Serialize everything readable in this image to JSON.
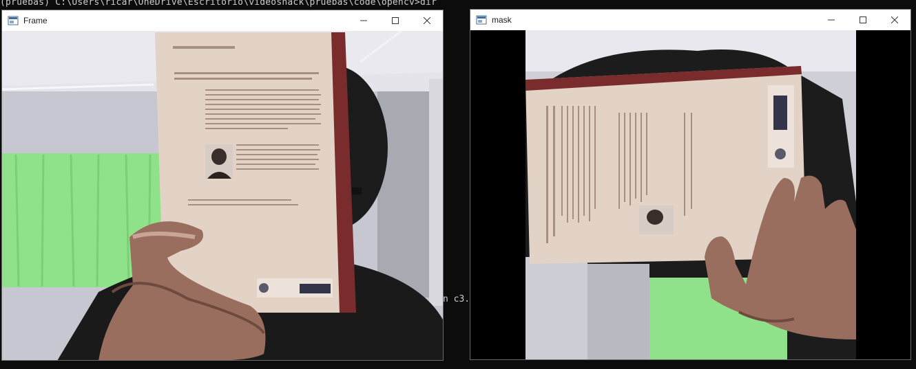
{
  "terminal": {
    "prompt_line": "(pruebas) C:\\Users\\ricar\\OneDrive\\Escritorio\\videoshack\\pruebas\\code\\opencv>dir",
    "fragment": "n c3."
  },
  "windows": {
    "frame": {
      "title": "Frame"
    },
    "mask": {
      "title": "mask"
    }
  },
  "icons": {
    "app": "opencv-window-icon",
    "minimize": "minimize-icon",
    "maximize": "maximize-icon",
    "close": "close-icon"
  },
  "colors": {
    "terminal_bg": "#0c0c0c",
    "terminal_text": "#cccccc",
    "titlebar_bg": "#ffffff",
    "book_cover": "#e2d2c6",
    "book_spine": "#7a2b2b",
    "curtain_green": "#8fe28a",
    "wall": "#c9c9d3"
  }
}
